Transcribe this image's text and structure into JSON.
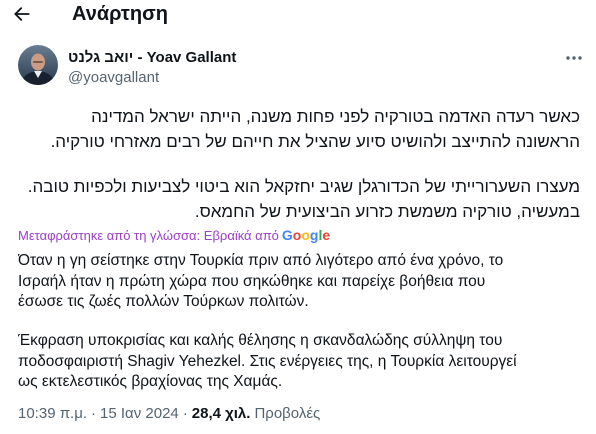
{
  "header": {
    "back_icon": "arrow-left-icon",
    "title": "Ανάρτηση"
  },
  "post": {
    "author": {
      "name": "יואב גלנט - Yoav Gallant",
      "handle": "@yoavgallant"
    },
    "more_icon": "more-horizontal-icon",
    "original": {
      "paragraphs": [
        {
          "lines": [
            "כאשר רעדה האדמה בטורקיה לפני פחות משנה, הייתה ישראל המדינה",
            "הראשונה להתייצב ולהושיט סיוע שהציל את חייהם של רבים מאזרחי טורקיה."
          ]
        },
        {
          "lines": [
            "מעצרו השערורייתי של הכדורגלן שגיב יחזקאל הוא ביטוי לצביעות ולכפיות טובה.",
            "במעשיה, טורקיה משמשת כזרוע הביצועית של החמאס."
          ]
        }
      ]
    },
    "translation": {
      "attribution_label": "Μεταφράστηκε από τη γλώσσα: Εβραϊκά από",
      "provider": "Google",
      "paragraphs": [
        {
          "lines": [
            "Όταν η γη σείστηκε στην Τουρκία πριν από λιγότερο από ένα χρόνο, το",
            "Ισραήλ ήταν η πρώτη χώρα που σηκώθηκε και παρείχε βοήθεια που",
            "έσωσε τις ζωές πολλών Τούρκων πολιτών."
          ]
        },
        {
          "lines": [
            "Έκφραση υποκρισίας και καλής θέλησης η σκανδαλώδης σύλληψη του",
            "ποδοσφαιριστή Shagiv Yehezkel. Στις ενέργειες της, η Τουρκία λειτουργεί",
            "ως εκτελεστικός βραχίονας της Χαμάς."
          ]
        }
      ]
    },
    "meta": {
      "time": "10:39 π.μ.",
      "separator": "·",
      "date": "15 Ιαν 2024",
      "views_count": "28,4 χιλ.",
      "views_label": "Προβολές"
    }
  },
  "colors": {
    "text": "#0f1419",
    "secondary_text": "#536471",
    "translation_accent": "#9b3fc7",
    "google_logo": [
      "#4285F4",
      "#EA4335",
      "#FBBC05",
      "#4285F4",
      "#34A853",
      "#EA4335"
    ]
  }
}
